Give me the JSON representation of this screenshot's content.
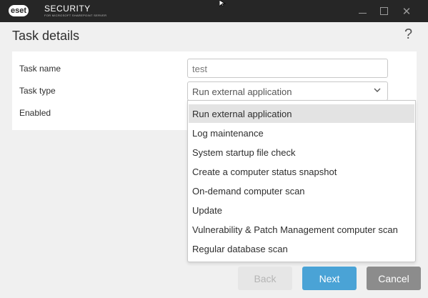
{
  "window": {
    "logo_text": "eset",
    "brand": "SECURITY",
    "brand_sub": "FOR MICROSOFT SHAREPOINT SERVER",
    "controls": {
      "minimize_icon": "minimize-icon",
      "maximize_icon": "maximize-icon",
      "close_glyph": "✕"
    }
  },
  "page": {
    "title": "Task details",
    "help_glyph": "?"
  },
  "form": {
    "task_name_label": "Task name",
    "task_name_value": "test",
    "task_type_label": "Task type",
    "task_type_value": "Run external application",
    "enabled_label": "Enabled"
  },
  "dropdown": {
    "options": [
      "Run external application",
      "Log maintenance",
      "System startup file check",
      "Create a computer status snapshot",
      "On-demand computer scan",
      "Update",
      "Vulnerability & Patch Management computer scan",
      "Regular database scan"
    ],
    "selected_index": 0
  },
  "buttons": {
    "back": "Back",
    "next": "Next",
    "cancel": "Cancel"
  },
  "colors": {
    "titlebar": "#262626",
    "next": "#4aa3d6",
    "cancel": "#8c8c8c",
    "back": "#e6e6e6"
  }
}
